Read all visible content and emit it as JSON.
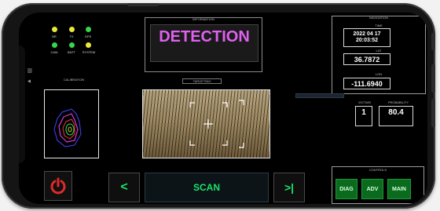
{
  "leds": [
    {
      "label": "BR",
      "color": "#e8e83a"
    },
    {
      "label": "TX",
      "color": "#e8e83a"
    },
    {
      "label": "GPS",
      "color": "#38d44a"
    },
    {
      "label": "CAM",
      "color": "#38d44a"
    },
    {
      "label": "BATT",
      "color": "#38d44a"
    },
    {
      "label": "SYSTEM",
      "color": "#e8e83a"
    }
  ],
  "calibration": {
    "label": "CALIBRATION"
  },
  "header": {
    "status_label": "INFORMATION",
    "status_text": "DETECTION",
    "status_color": "#e060f0"
  },
  "targeting": {
    "label": "TARGETING"
  },
  "navigation": {
    "label": "NAVIGATION",
    "time_label": "TIME",
    "date": "2022  04  17",
    "time": "20:03:52",
    "lat_label": "LAT",
    "lat": "36.7872",
    "lon_label": "LON",
    "lon": "-111.6940"
  },
  "stats": {
    "victims_label": "VICTIMS",
    "victims": "1",
    "probability_label": "PROBABILITY",
    "probability": "80.4"
  },
  "controls": {
    "label": "CONTROLS",
    "prev": "<",
    "scan": "SCAN",
    "next": ">|",
    "diag": "DIAG",
    "adv": "ADV",
    "main": "MAIN"
  },
  "icons": {
    "power": "power-icon",
    "crosshair": "crosshair-icon"
  }
}
